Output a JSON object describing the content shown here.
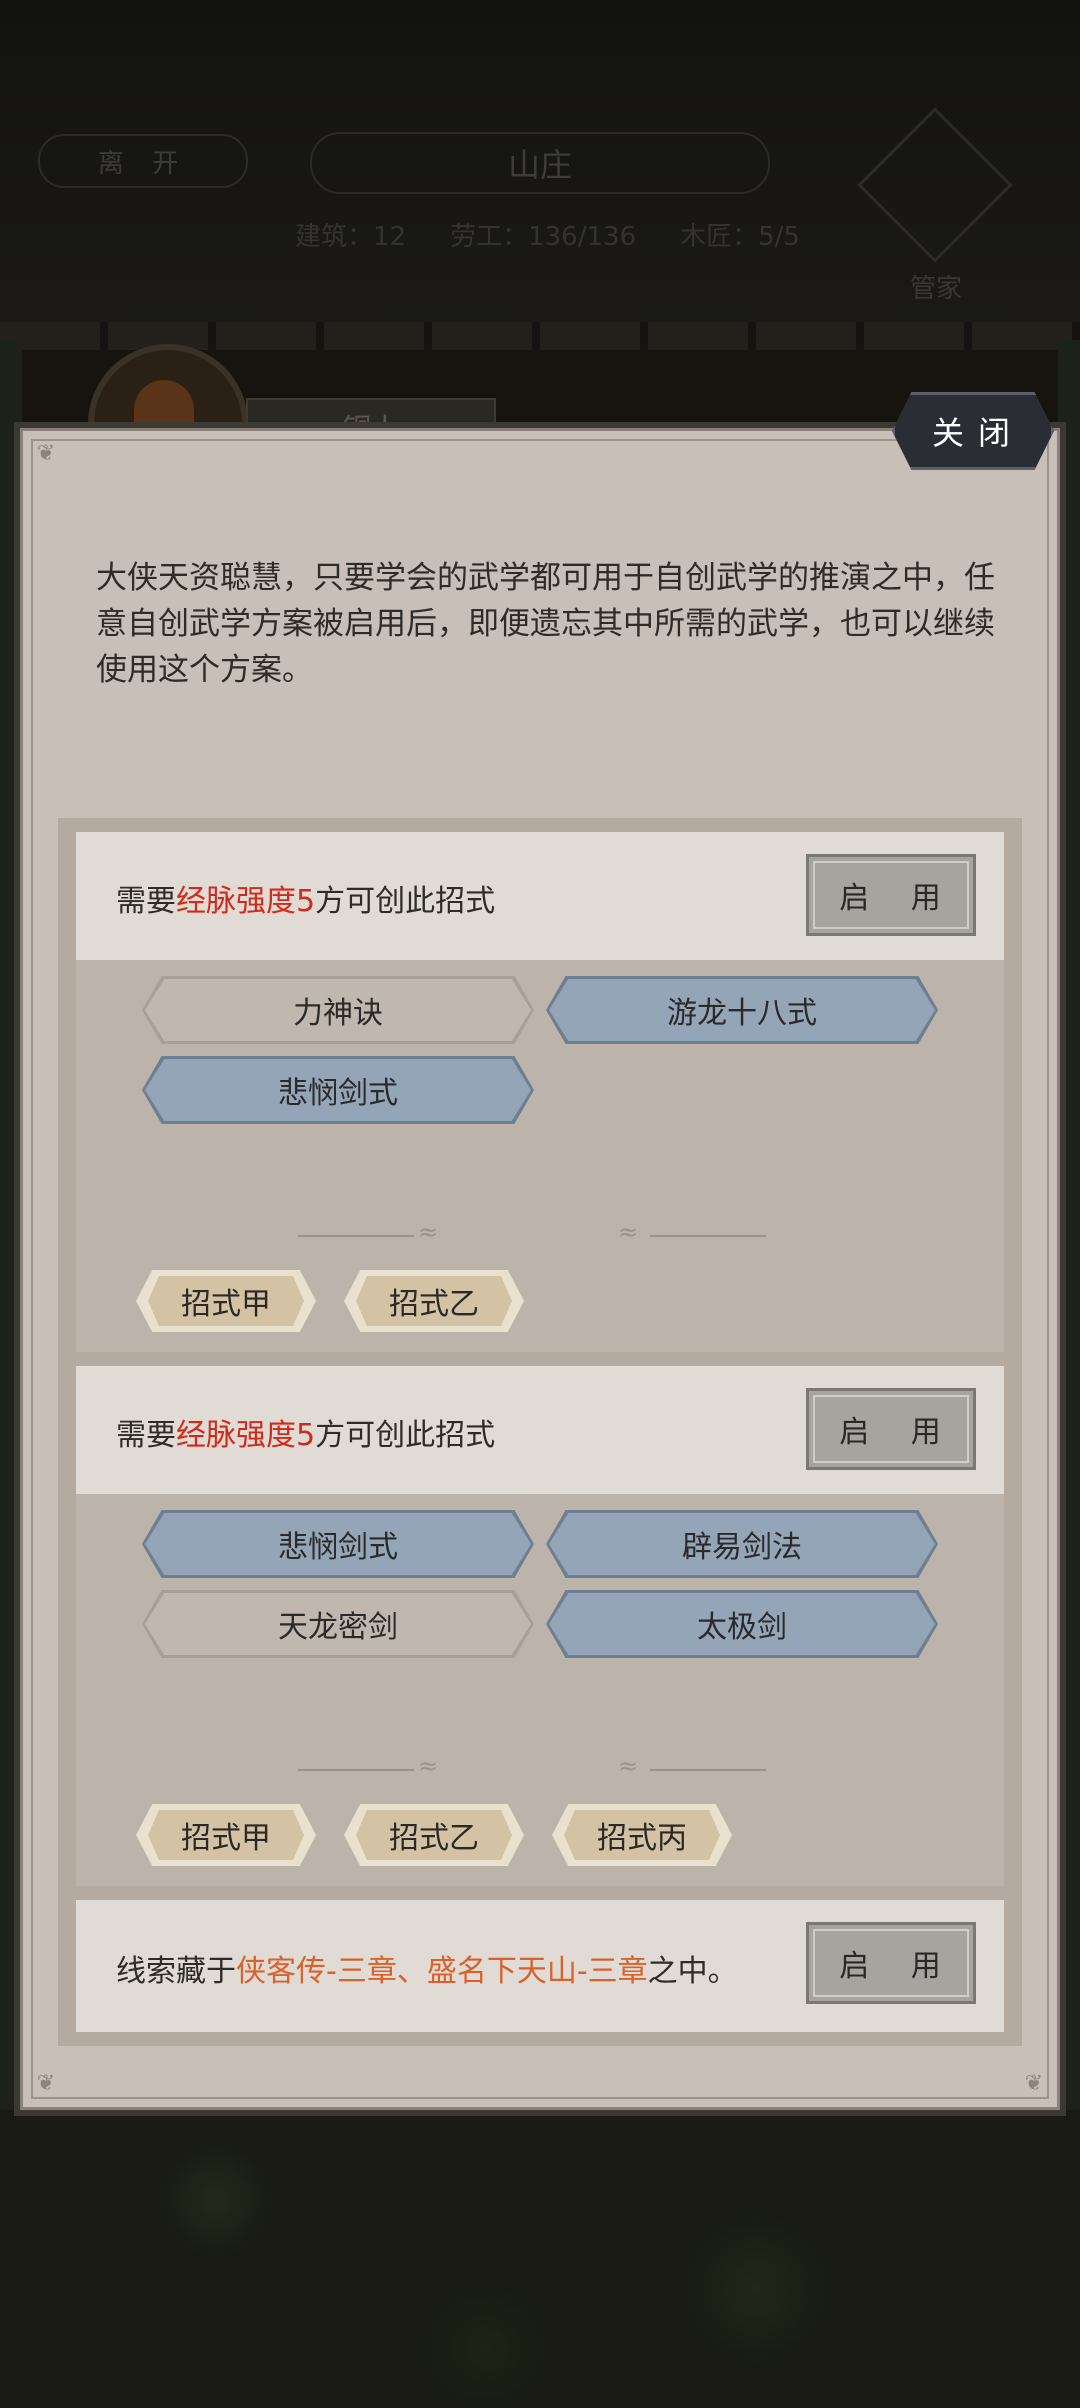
{
  "background": {
    "leave_label": "离 开",
    "location_title": "山庄",
    "stats": [
      "建筑：12",
      "劳工：136/136",
      "木匠：5/5"
    ],
    "left_info_1": "·",
    "left_info_2": "",
    "steward_label": "管家",
    "npc_name": "铜人"
  },
  "modal": {
    "close_label": "关闭",
    "intro": "大侠天资聪慧，只要学会的武学都可用于自创武学的推演之中，任意自创武学方案被启用后，即便遗忘其中所需的武学，也可以继续使用这个方案。",
    "enable_label": "启 用",
    "blocks": [
      {
        "req_prefix": "需要",
        "req_highlight": "经脉强度5",
        "req_suffix": "方可创此招式",
        "skills": [
          {
            "name": "力神诀",
            "learned": false
          },
          {
            "name": "游龙十八式",
            "learned": true
          },
          {
            "name": "悲悯剑式",
            "learned": true
          }
        ],
        "moves": [
          "招式甲",
          "招式乙"
        ]
      },
      {
        "req_prefix": "需要",
        "req_highlight": "经脉强度5",
        "req_suffix": "方可创此招式",
        "skills": [
          {
            "name": "悲悯剑式",
            "learned": true
          },
          {
            "name": "辟易剑法",
            "learned": true
          },
          {
            "name": "天龙密剑",
            "learned": false
          },
          {
            "name": "太极剑",
            "learned": true
          }
        ],
        "moves": [
          "招式甲",
          "招式乙",
          "招式丙"
        ]
      },
      {
        "clue_prefix": "线索藏于",
        "clue_highlight": "侠客传-三章、盛名下天山-三章",
        "clue_suffix": "之中。"
      }
    ]
  },
  "colors": {
    "modal_bg": "#c7bfb8",
    "learned_skill": "#94a5b8",
    "unlearned_skill": "#c0b8ae",
    "requirement_red": "#d22a1a",
    "clue_orange": "#d9622c"
  }
}
